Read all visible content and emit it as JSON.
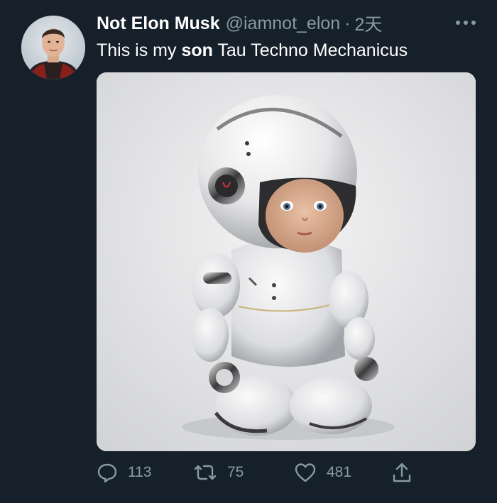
{
  "tweet": {
    "author": {
      "display_name": "Not Elon Musk",
      "handle": "@iamnot_elon",
      "time": "2天"
    },
    "separator": "·",
    "text": {
      "before": "This is my ",
      "bold": "son",
      "after": " Tau Techno Mechanicus"
    },
    "media": {
      "image_kind": "robot-baby-photo"
    },
    "actions": {
      "reply_count": "113",
      "retweet_count": "75",
      "like_count": "481"
    },
    "icons": {
      "more": "more-dots-icon",
      "reply": "reply-bubble-icon",
      "retweet": "retweet-arrows-icon",
      "like": "heart-icon",
      "share": "share-upload-icon"
    },
    "colors": {
      "background": "#15202b",
      "text": "#ffffff",
      "muted": "#8899a6"
    }
  }
}
